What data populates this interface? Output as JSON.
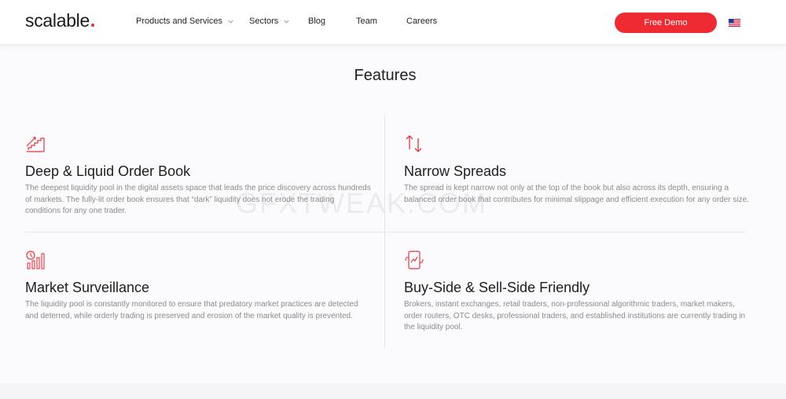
{
  "brand": {
    "name": "scalable",
    "accent_color": "#ee2a33"
  },
  "nav": {
    "items": [
      {
        "label": "Products and Services",
        "has_dropdown": true
      },
      {
        "label": "Sectors",
        "has_dropdown": true
      },
      {
        "label": "Blog",
        "has_dropdown": false
      },
      {
        "label": "Team",
        "has_dropdown": false
      },
      {
        "label": "Careers",
        "has_dropdown": false
      }
    ],
    "cta_label": "Free Demo",
    "language_icon": "us-flag-icon"
  },
  "features": {
    "title": "Features",
    "items": [
      {
        "icon": "rising-chart-icon",
        "title": "Deep & Liquid Order Book",
        "description": "The deepest liquidity pool in the digital assets space that leads the price discovery across hundreds of markets. The fully-lit order book ensures that “dark” liquidity does not erode the trading conditions for any one trader."
      },
      {
        "icon": "up-down-arrows-icon",
        "title": "Narrow Spreads",
        "description": "The spread is kept narrow not only at the top of the book but also across its depth, ensuring a balanced order book that contributes for minimal slippage and efficient execution for any order size."
      },
      {
        "icon": "surveillance-chart-icon",
        "title": "Market Surveillance",
        "description": "The liquidity pool is constantly monitored to ensure that predatory market practices are detected and deterred, while orderly trading is preserved and erosion of the market quality is prevented."
      },
      {
        "icon": "mobile-trading-icon",
        "title": "Buy-Side & Sell-Side Friendly",
        "description": "Brokers, instant exchanges, retail traders, non-professional algorithmic traders, market makers, order routers, OTC desks, professional traders, and established institutions are currently trading in the liquidity pool."
      }
    ]
  },
  "watermark": "GFXTWEAK.COM"
}
